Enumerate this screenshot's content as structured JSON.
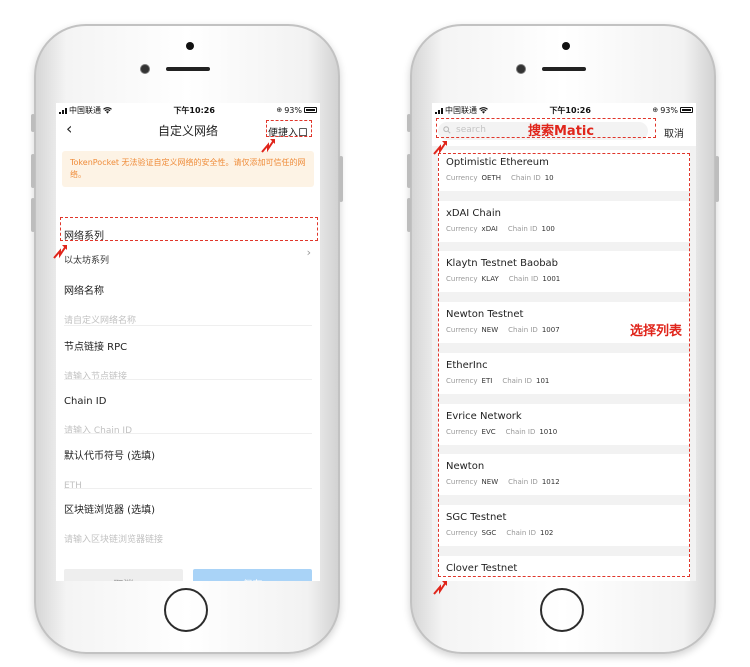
{
  "status_bar": {
    "carrier": "中国联通",
    "time": "下午10:26",
    "battery": "93%"
  },
  "left_screen": {
    "title": "自定义网络",
    "back_icon": "chevron-left-icon",
    "quick_entry": "便捷入口",
    "warning": "TokenPocket 无法验证自定义网络的安全性。请仅添加可信任的网络。",
    "fields": [
      {
        "label": "网络系列",
        "value": "以太坊系列",
        "type": "select"
      },
      {
        "label": "网络名称",
        "placeholder": "请自定义网络名称"
      },
      {
        "label": "节点链接 RPC",
        "placeholder": "请输入节点链接"
      },
      {
        "label": "Chain ID",
        "placeholder": "请输入 Chain ID"
      },
      {
        "label": "默认代币符号 (选填)",
        "placeholder": "ETH"
      },
      {
        "label": "区块链浏览器 (选填)",
        "placeholder": "请输入区块链浏览器链接"
      }
    ],
    "cancel_label": "取消",
    "save_label": "保存"
  },
  "right_screen": {
    "search_placeholder": "search",
    "search_annotation": "搜索Matic",
    "cancel_label": "取消",
    "list_annotation": "选择列表",
    "currency_label": "Currency",
    "chain_id_label": "Chain ID",
    "networks": [
      {
        "name": "Optimistic Ethereum",
        "currency": "OETH",
        "chain_id": "10"
      },
      {
        "name": "xDAI Chain",
        "currency": "xDAI",
        "chain_id": "100"
      },
      {
        "name": "Klaytn Testnet Baobab",
        "currency": "KLAY",
        "chain_id": "1001"
      },
      {
        "name": "Newton Testnet",
        "currency": "NEW",
        "chain_id": "1007"
      },
      {
        "name": "EtherInc",
        "currency": "ETI",
        "chain_id": "101"
      },
      {
        "name": "Evrice Network",
        "currency": "EVC",
        "chain_id": "1010"
      },
      {
        "name": "Newton",
        "currency": "NEW",
        "chain_id": "1012"
      },
      {
        "name": "SGC Testnet",
        "currency": "SGC",
        "chain_id": "102"
      },
      {
        "name": "Clover Testnet",
        "currency": "",
        "chain_id": ""
      }
    ]
  },
  "colors": {
    "annotation": "#e0251b",
    "warning_text": "#ef8c3a",
    "warning_bg": "#fdf3e5",
    "save_button": "#a9d3f7"
  }
}
